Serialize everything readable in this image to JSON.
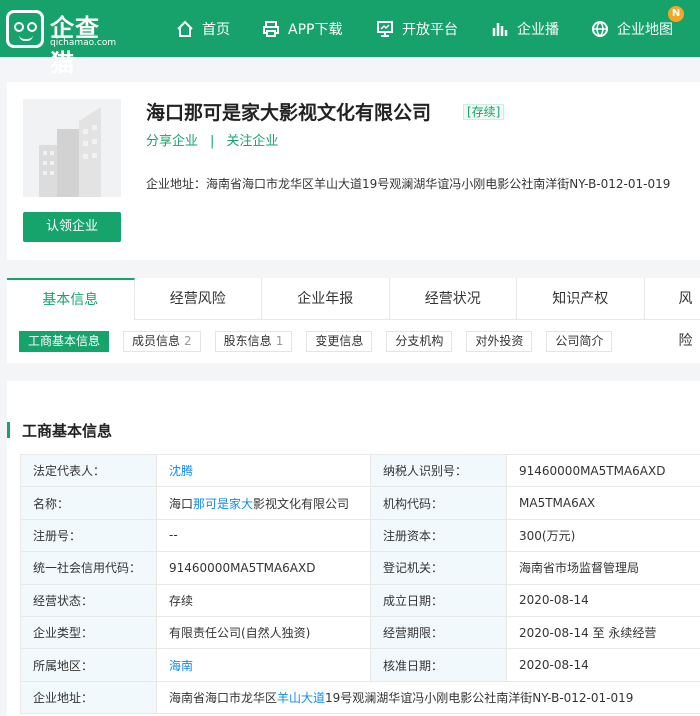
{
  "header": {
    "logo_text": "企查猫",
    "logo_sub": "qichamao.com",
    "nav": [
      {
        "label": "首页",
        "icon": "home-icon"
      },
      {
        "label": "APP下载",
        "icon": "printer-icon"
      },
      {
        "label": "开放平台",
        "icon": "monitor-icon"
      },
      {
        "label": "企业播",
        "icon": "bar-chart-icon"
      },
      {
        "label": "企业地图",
        "icon": "globe-icon"
      }
    ],
    "new_badge": "N"
  },
  "company": {
    "name": "海口那可是家大影视文化有限公司",
    "status": "[存续]",
    "share": "分享企业",
    "sep": "|",
    "follow": "关注企业",
    "address_label": "企业地址：",
    "address": "海南省海口市龙华区羊山大道19号观澜湖华谊冯小刚电影公社南洋街NY-B-012-01-019",
    "claim_label": "认领企业"
  },
  "tabs": [
    "基本信息",
    "经营风险",
    "企业年报",
    "经营状况",
    "知识产权",
    "风险"
  ],
  "subtabs": [
    {
      "label": "工商基本信息",
      "count": ""
    },
    {
      "label": "成员信息",
      "count": "2"
    },
    {
      "label": "股东信息",
      "count": "1"
    },
    {
      "label": "变更信息",
      "count": ""
    },
    {
      "label": "分支机构",
      "count": ""
    },
    {
      "label": "对外投资",
      "count": ""
    },
    {
      "label": "公司简介",
      "count": ""
    }
  ],
  "info": {
    "title": "工商基本信息",
    "rows": [
      {
        "l1": "法定代表人：",
        "v1": "沈腾",
        "l2": "纳税人识别号：",
        "v2": "91460000MA5TMA6AXD"
      },
      {
        "l1": "名称：",
        "v1_pre": "海口",
        "v1_link": "那可是家大",
        "v1_post": "影视文化有限公司",
        "l2": "机构代码：",
        "v2": "MA5TMA6AX"
      },
      {
        "l1": "注册号：",
        "v1": "--",
        "l2": "注册资本：",
        "v2": "300(万元)"
      },
      {
        "l1": "统一社会信用代码：",
        "v1": "91460000MA5TMA6AXD",
        "l2": "登记机关：",
        "v2": "海南省市场监督管理局"
      },
      {
        "l1": "经营状态：",
        "v1": "存续",
        "l2": "成立日期：",
        "v2": "2020-08-14"
      },
      {
        "l1": "企业类型：",
        "v1": "有限责任公司(自然人独资)",
        "l2": "经营期限：",
        "v2": "2020-08-14 至 永续经营"
      },
      {
        "l1": "所属地区：",
        "v1": "海南",
        "l2": "核准日期：",
        "v2": "2020-08-14"
      },
      {
        "l1": "企业地址：",
        "addr_pre": "海南省海口市龙华区",
        "addr_link": "羊山大道",
        "addr_post": "19号观澜湖华谊冯小刚电影公社南洋街NY-B-012-01-019"
      }
    ]
  }
}
